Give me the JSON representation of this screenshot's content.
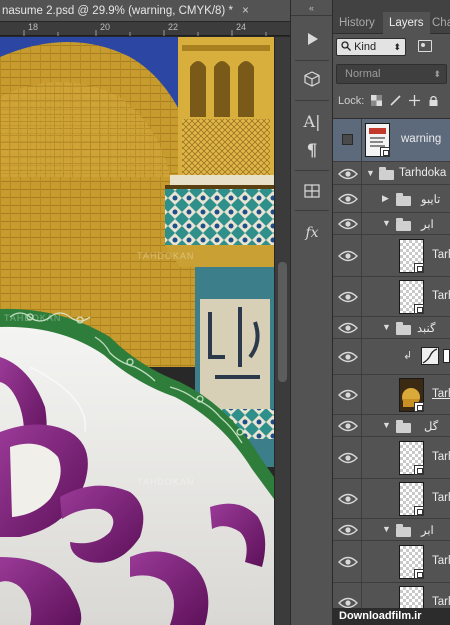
{
  "document": {
    "tab_title": "nasume 2.psd @ 29.9% (warning, CMYK/8) *",
    "close_glyph": "×",
    "ruler_ticks": [
      "18",
      "20",
      "22",
      "24"
    ],
    "watermarks": [
      "TAHDOKAN",
      "TAHDOKAN",
      "TAHDOKAN"
    ]
  },
  "strip": {
    "collapse_glyph": "«",
    "tools": [
      {
        "icon": "play-icon"
      },
      {
        "icon": "3d-cube-icon"
      },
      {
        "icon": "character-icon",
        "glyph": "A|"
      },
      {
        "icon": "paragraph-icon",
        "glyph": "¶"
      },
      {
        "icon": "grid-icon"
      },
      {
        "icon": "fx-icon",
        "glyph": "fx"
      }
    ]
  },
  "layers_panel": {
    "tabs": [
      {
        "label": "History",
        "active": false
      },
      {
        "label": "Layers",
        "active": true
      },
      {
        "label": "Cha",
        "active": false
      }
    ],
    "filter_kind": "Kind",
    "blend_mode": "Normal",
    "lock_label": "Lock:",
    "layers": [
      {
        "name": "warning",
        "type": "layer",
        "selected": true,
        "visible": false
      },
      {
        "name": "Tarhdoka",
        "type": "group",
        "expanded": true
      },
      {
        "name": "تایبو",
        "type": "group",
        "expanded": false
      },
      {
        "name": "ابر",
        "type": "group",
        "expanded": true
      },
      {
        "name": "Tarh",
        "type": "smart"
      },
      {
        "name": "Tarh",
        "type": "smart"
      },
      {
        "name": "گنبد",
        "type": "group",
        "expanded": true
      },
      {
        "name": "",
        "type": "adjustment"
      },
      {
        "name": "Tarh",
        "type": "smart-image"
      },
      {
        "name": "گل",
        "type": "group",
        "expanded": true
      },
      {
        "name": "Tarh",
        "type": "smart"
      },
      {
        "name": "Tarh",
        "type": "smart"
      },
      {
        "name": "ابر",
        "type": "group",
        "expanded": true
      },
      {
        "name": "Tarh",
        "type": "smart"
      },
      {
        "name": "Tarh",
        "type": "smart"
      }
    ]
  },
  "watermark_text": "Downloadfilm.ir",
  "colors": {
    "panel_bg": "#535353",
    "selected_row": "#5d6a7c",
    "gold": "#c9a033",
    "purple": "#7a1f78",
    "green": "#2e7d3a",
    "sky": "#2a45a0"
  }
}
